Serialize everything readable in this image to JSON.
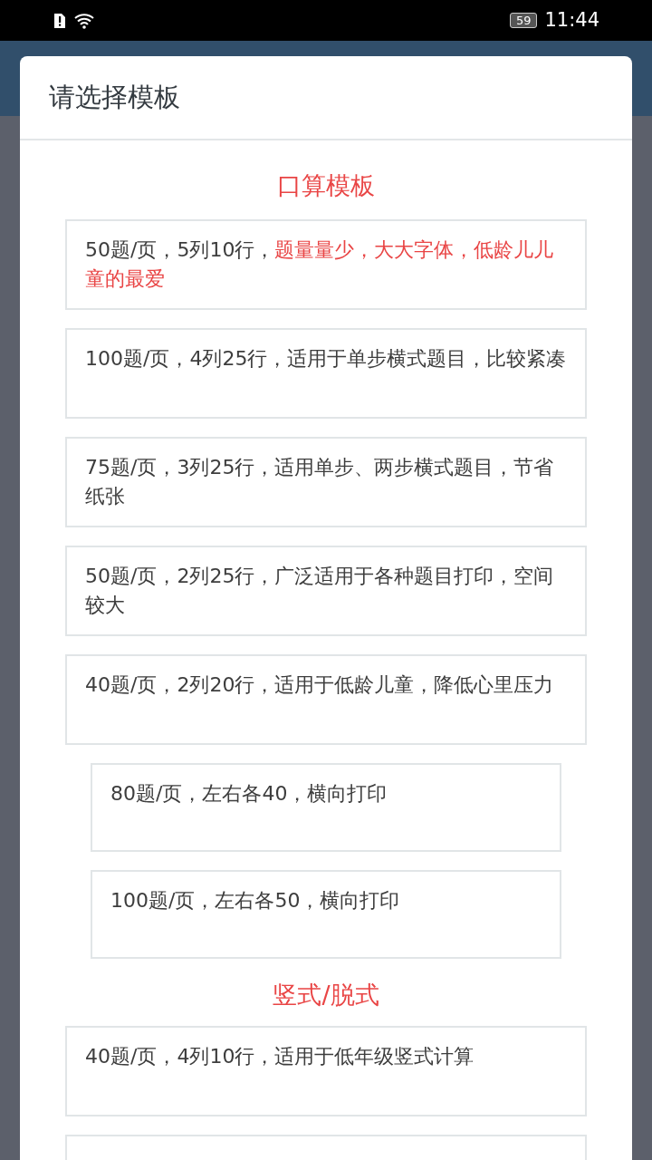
{
  "status_bar": {
    "time": "11:44",
    "battery": "59"
  },
  "dialog": {
    "title": "请选择模板",
    "sections": [
      {
        "heading": "口算模板",
        "items": [
          {
            "kind": "wide",
            "text": "50题/页，5列10行，",
            "highlight_text": "题量量少，大大字体，低龄儿儿童的最爱"
          },
          {
            "kind": "wide",
            "text": "100题/页，4列25行，适用于单步横式题目，比较紧凑"
          },
          {
            "kind": "wide",
            "text": "75题/页，3列25行，适用单步、两步横式题目，节省纸张"
          },
          {
            "kind": "wide",
            "text": "50题/页，2列25行，广泛适用于各种题目打印，空间较大"
          },
          {
            "kind": "wide",
            "text": "40题/页，2列20行，适用于低龄儿童，降低心里压力"
          },
          {
            "kind": "narrow",
            "text": "80题/页，左右各40，横向打印"
          },
          {
            "kind": "narrow",
            "text": "100题/页，左右各50，横向打印"
          }
        ]
      },
      {
        "heading": "竖式/脱式",
        "items": [
          {
            "kind": "wide",
            "text": "40题/页，4列10行，适用于低年级竖式计算"
          },
          {
            "kind": "wide"
          }
        ]
      }
    ]
  }
}
